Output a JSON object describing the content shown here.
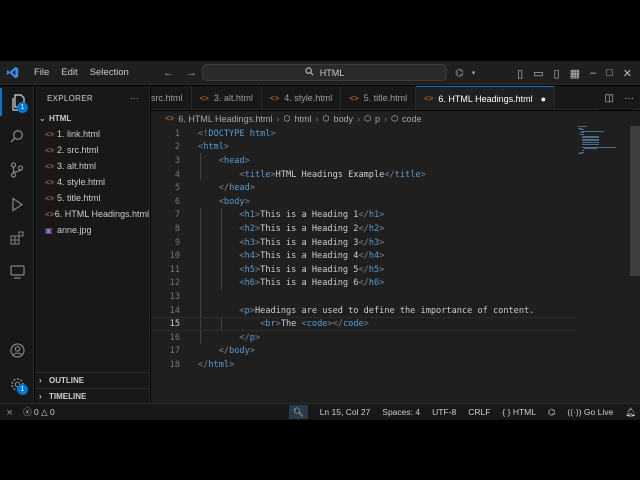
{
  "titlebar": {
    "menu": [
      "File",
      "Edit",
      "Selection"
    ],
    "search_text": "HTML"
  },
  "sidebar": {
    "header": "EXPLORER",
    "folder": "HTML",
    "files": [
      "1. link.html",
      "2. src.html",
      "3. alt.html",
      "4. style.html",
      "5. title.html",
      "6. HTML Headings.html",
      "anne.jpg"
    ],
    "outline": "OUTLINE",
    "timeline": "TIMELINE"
  },
  "activity": {
    "explorer_badge": "1",
    "settings_badge": "1"
  },
  "tabs": [
    "src.html",
    "3. alt.html",
    "4. style.html",
    "5. title.html",
    "6. HTML Headings.html"
  ],
  "breadcrumb": [
    "6. HTML Headings.html",
    "html",
    "body",
    "p",
    "code"
  ],
  "editor": {
    "lines": [
      {
        "n": "1",
        "code": "<!DOCTYPE html>"
      },
      {
        "n": "2",
        "code": "<html>"
      },
      {
        "n": "3",
        "code": "    <head>"
      },
      {
        "n": "4",
        "code": "        <title>HTML Headings Example</title>"
      },
      {
        "n": "5",
        "code": "    </head>"
      },
      {
        "n": "6",
        "code": "    <body>"
      },
      {
        "n": "7",
        "code": "        <h1>This is a Heading 1</h1>"
      },
      {
        "n": "8",
        "code": "        <h2>This is a Heading 2</h2>"
      },
      {
        "n": "9",
        "code": "        <h3>This is a Heading 3</h3>"
      },
      {
        "n": "10",
        "code": "        <h4>This is a Heading 4</h4>"
      },
      {
        "n": "11",
        "code": "        <h5>This is a Heading 5</h5>"
      },
      {
        "n": "12",
        "code": "        <h6>This is a Heading 6</h6>"
      },
      {
        "n": "13",
        "code": ""
      },
      {
        "n": "14",
        "code": "        <p>Headings are used to define the importance of content."
      },
      {
        "n": "15",
        "code": "            <br>The <code></code>"
      },
      {
        "n": "16",
        "code": "        </p>"
      },
      {
        "n": "17",
        "code": "    </body>"
      },
      {
        "n": "18",
        "code": "</html>"
      }
    ],
    "current_line": "15"
  },
  "statusbar": {
    "errors": "0",
    "warnings": "0",
    "position": "Ln 15, Col 27",
    "spaces": "Spaces: 4",
    "encoding": "UTF-8",
    "eol": "CRLF",
    "language": "HTML",
    "golive": "Go Live"
  },
  "colors": {
    "accent": "#0078d4",
    "tag": "#569cd6",
    "bracket": "#808080",
    "html_icon": "#e37933"
  }
}
